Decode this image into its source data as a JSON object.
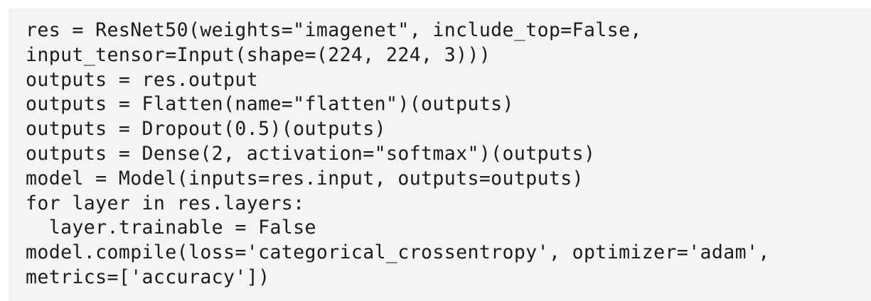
{
  "code": {
    "lines": [
      "res = ResNet50(weights=\"imagenet\", include_top=False,",
      "input_tensor=Input(shape=(224, 224, 3)))",
      "outputs = res.output",
      "outputs = Flatten(name=\"flatten\")(outputs)",
      "outputs = Dropout(0.5)(outputs)",
      "outputs = Dense(2, activation=\"softmax\")(outputs)",
      "model = Model(inputs=res.input, outputs=outputs)",
      "for layer in res.layers:",
      "  layer.trainable = False",
      "model.compile(loss='categorical_crossentropy', optimizer='adam',",
      "metrics=['accuracy'])"
    ]
  },
  "colors": {
    "background": "#f4f4f4",
    "text": "#1c1c1c"
  }
}
